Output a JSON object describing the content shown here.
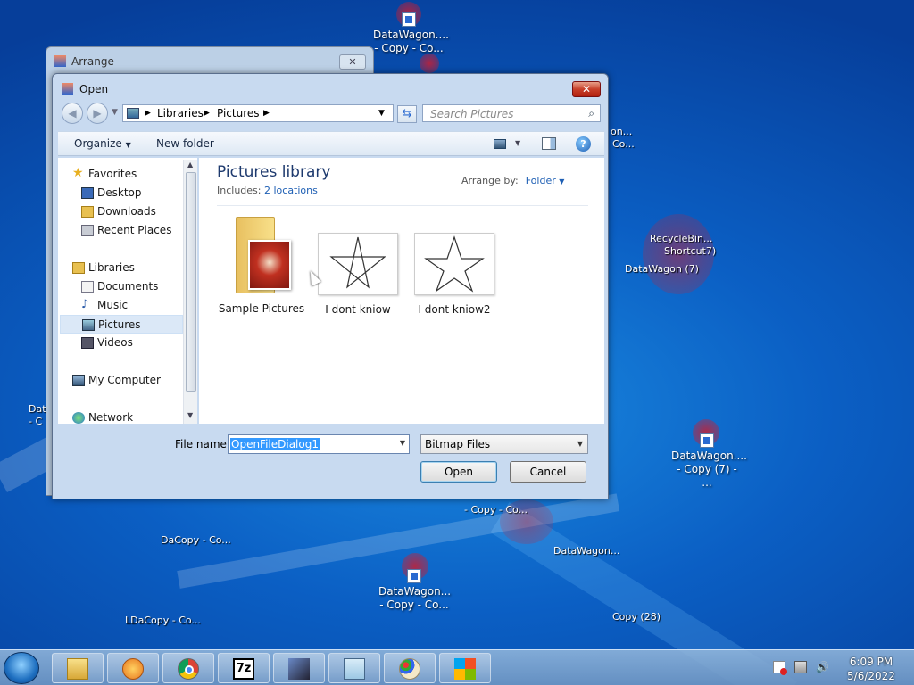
{
  "desktop": {
    "icons": [
      {
        "label": "DataWagon....\n- Copy - Co..."
      },
      {
        "label": "DataWagon....\n- Copy (7) - ..."
      },
      {
        "label": "DataWagon...\n- Copy - Co..."
      }
    ],
    "clutter_text": [
      "Data",
      "- C",
      "on...",
      "Co...",
      "RecycleBin...",
      "Shortcut7)",
      "DataWagon (7)",
      "Copy (28)",
      "- Copy - Co...",
      "DataWagon...",
      "DaCopy - Co...",
      "LDaCopy - Co..."
    ]
  },
  "arrange_window": {
    "title": "Arrange",
    "close": "✕"
  },
  "dialog": {
    "title": "Open",
    "close": "✕",
    "address": {
      "part1": "Libraries",
      "part2": "Pictures"
    },
    "search_placeholder": "Search Pictures",
    "toolbar": {
      "organize": "Organize",
      "new_folder": "New folder"
    },
    "nav": {
      "favorites": "Favorites",
      "desktop": "Desktop",
      "downloads": "Downloads",
      "recent": "Recent Places",
      "libraries": "Libraries",
      "documents": "Documents",
      "music": "Music",
      "pictures": "Pictures",
      "videos": "Videos",
      "my_computer": "My Computer",
      "network": "Network"
    },
    "library": {
      "title": "Pictures library",
      "includes_label": "Includes:",
      "includes_link": "2 locations",
      "arrange_label": "Arrange by:",
      "arrange_value": "Folder"
    },
    "files": [
      {
        "name": "Sample Pictures",
        "kind": "folder"
      },
      {
        "name": "I dont kniow",
        "kind": "star-image"
      },
      {
        "name": "I dont kniow2",
        "kind": "star-image"
      }
    ],
    "file_name_label": "File name:",
    "file_name_value": "OpenFileDialog1",
    "file_type": "Bitmap Files",
    "open_button": "Open",
    "cancel_button": "Cancel"
  },
  "taskbar": {
    "items": [
      "explorer",
      "media-player",
      "chrome",
      "7zip",
      "paint-app",
      "notepad",
      "paint",
      "office"
    ],
    "time": "6:09 PM",
    "date": "5/6/2022"
  }
}
